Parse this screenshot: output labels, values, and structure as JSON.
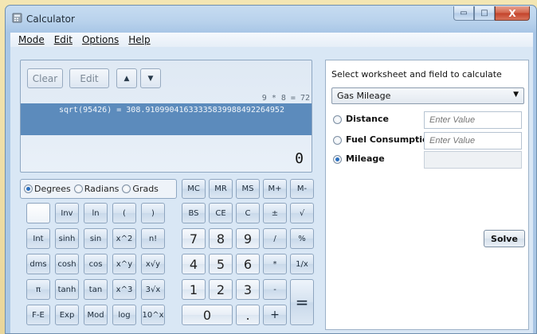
{
  "window": {
    "title": "Calculator",
    "min_glyph": "▭",
    "max_glyph": "□",
    "close_glyph": "X"
  },
  "menu": [
    "Mode",
    "Edit",
    "Options",
    "Help"
  ],
  "display": {
    "clear_label": "Clear",
    "edit_label": "Edit",
    "up_glyph": "▲",
    "down_glyph": "▼",
    "history_prev": "9 * 8 = 72",
    "history_selected": "sqrt(95426) = 308.91099041633335839988492264952",
    "result": "0"
  },
  "angle_modes": [
    {
      "label": "Degrees",
      "selected": true
    },
    {
      "label": "Radians",
      "selected": false
    },
    {
      "label": "Grads",
      "selected": false
    }
  ],
  "keys": {
    "memory": [
      "MC",
      "MR",
      "MS",
      "M+",
      "M-"
    ],
    "row1": [
      "",
      "Inv",
      "ln",
      "(",
      ")",
      "BS",
      "CE",
      "C",
      "±",
      "√"
    ],
    "row2": [
      "Int",
      "sinh",
      "sin",
      "x^2",
      "n!",
      "7",
      "8",
      "9",
      "/",
      "%"
    ],
    "row3": [
      "dms",
      "cosh",
      "cos",
      "x^y",
      "x√y",
      "4",
      "5",
      "6",
      "*",
      "1/x"
    ],
    "row4": [
      "π",
      "tanh",
      "tan",
      "x^3",
      "3√x",
      "1",
      "2",
      "3",
      "-",
      "="
    ],
    "row5": [
      "F-E",
      "Exp",
      "Mod",
      "log",
      "10^x",
      "0",
      ".",
      "+"
    ]
  },
  "worksheet": {
    "title": "Select worksheet and field to calculate",
    "selected": "Gas Mileage",
    "fields": [
      {
        "label": "Distance",
        "placeholder": "Enter Value",
        "selected": false
      },
      {
        "label": "Fuel Consumption",
        "placeholder": "Enter Value",
        "selected": false
      },
      {
        "label": "Mileage",
        "placeholder": "",
        "selected": true
      }
    ],
    "solve_label": "Solve"
  },
  "colors": {
    "history_highlight": "#5c8bbc",
    "accent": "#2a6fc0"
  }
}
